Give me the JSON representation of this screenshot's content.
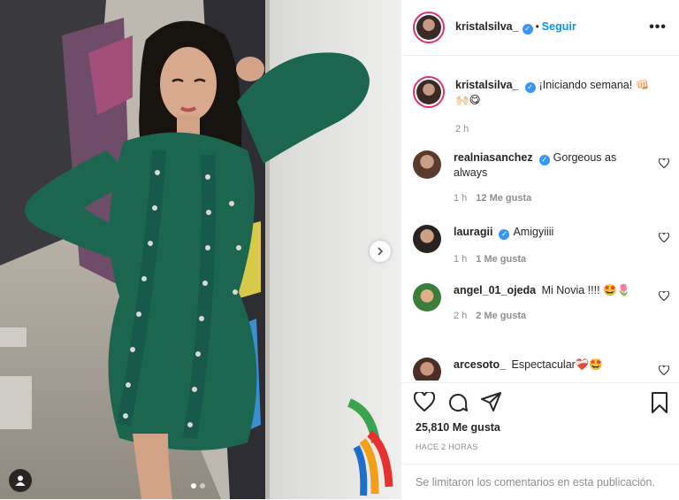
{
  "post": {
    "username": "kristalsilva_",
    "follow_label": "Seguir",
    "more_label": "•••",
    "caption": "¡Iniciando semana! 👊🏻🙌🏻😋",
    "caption_time": "2 h",
    "comments": [
      {
        "username": "realniasanchez",
        "verified": true,
        "text": "Gorgeous as always",
        "time": "1 h",
        "likes": "12 Me gusta"
      },
      {
        "username": "lauragii",
        "verified": true,
        "text": "Amigyiiii",
        "time": "1 h",
        "likes": "1 Me gusta"
      },
      {
        "username": "angel_01_ojeda",
        "verified": false,
        "text": "Mi Novia !!!! 🤩🌷",
        "time": "2 h",
        "likes": "2 Me gusta"
      },
      {
        "username": "arcesoto_",
        "verified": false,
        "text": "Espectacular❤️‍🩹🤩",
        "time": "",
        "likes": ""
      }
    ],
    "likes_count": "25,810 Me gusta",
    "timestamp": "HACE 2 HORAS",
    "comments_limited": "Se limitaron los comentarios en esta publicación.",
    "carousel": {
      "current": 1,
      "total": 2
    }
  },
  "colors": {
    "accent": "#0095f6",
    "verified": "#3897f0",
    "dress": "#1c6650"
  },
  "icons": [
    "heart-icon",
    "comment-icon",
    "share-icon",
    "bookmark-icon",
    "tag-user-icon",
    "chevron-right-icon",
    "more-icon",
    "verified-badge-icon"
  ]
}
